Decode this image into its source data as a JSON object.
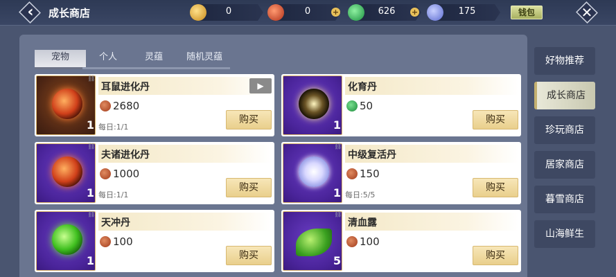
{
  "header": {
    "title": "成长商店",
    "currencies": [
      {
        "icon": "gold-coin-icon",
        "value": "0"
      },
      {
        "icon": "red-coin-icon",
        "value": "0"
      },
      {
        "icon": "jade-coin-icon",
        "value": "626"
      },
      {
        "icon": "crystal-icon",
        "value": "175"
      }
    ],
    "wallet_label": "钱包"
  },
  "tabs": [
    {
      "label": "宠物",
      "active": true
    },
    {
      "label": "个人",
      "active": false
    },
    {
      "label": "灵蕴",
      "active": false
    },
    {
      "label": "随机灵蕴",
      "active": false
    }
  ],
  "items": [
    {
      "name": "耳鼠进化丹",
      "price": "2680",
      "currency": "red-coin-icon",
      "daily": "每日:1/1",
      "qty": "1",
      "style": "orange",
      "orb": "fire",
      "video": true
    },
    {
      "name": "化育丹",
      "price": "50",
      "currency": "jade-coin-icon",
      "daily": "",
      "qty": "1",
      "style": "purple",
      "orb": "gold",
      "video": false
    },
    {
      "name": "夫诸进化丹",
      "price": "1000",
      "currency": "red-coin-icon",
      "daily": "每日:1/1",
      "qty": "1",
      "style": "purple",
      "orb": "fire",
      "video": false
    },
    {
      "name": "中级复活丹",
      "price": "150",
      "currency": "red-coin-icon",
      "daily": "每日:5/5",
      "qty": "1",
      "style": "purple",
      "orb": "crystal",
      "video": false
    },
    {
      "name": "天冲丹",
      "price": "100",
      "currency": "red-coin-icon",
      "daily": "",
      "qty": "1",
      "style": "purple",
      "orb": "green",
      "video": false
    },
    {
      "name": "清血露",
      "price": "100",
      "currency": "red-coin-icon",
      "daily": "",
      "qty": "5",
      "style": "purple",
      "orb": "leaf",
      "video": false
    }
  ],
  "buy_label": "购买",
  "side_nav": [
    {
      "label": "好物推荐",
      "active": false
    },
    {
      "label": "成长商店",
      "active": true
    },
    {
      "label": "珍玩商店",
      "active": false
    },
    {
      "label": "居家商店",
      "active": false
    },
    {
      "label": "暮雪商店",
      "active": false
    },
    {
      "label": "山海鲜生",
      "active": false
    }
  ]
}
